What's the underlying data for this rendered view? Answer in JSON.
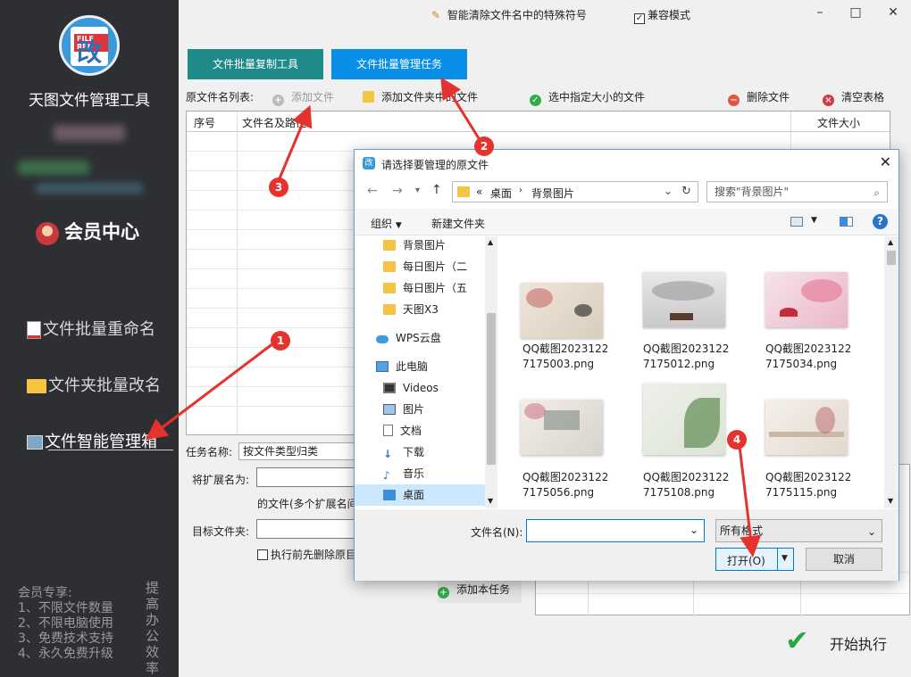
{
  "app": {
    "logo_tag": "FILE REN",
    "logo_char": "改",
    "title": "天图文件管理工具",
    "member_center": "会员中心",
    "nav": [
      {
        "label": "文件批量重命名",
        "icon": "document-icon"
      },
      {
        "label": "文件夹批量改名",
        "icon": "folder-icon"
      },
      {
        "label": "文件智能管理箱",
        "icon": "manager-icon"
      }
    ],
    "perks": [
      "会员专享:",
      "1、不限文件数量",
      "2、不限电脑使用",
      "3、免费技术支持",
      "4、永久免费升级"
    ],
    "slogan": "提高办公效率"
  },
  "titlebar": {
    "tip": "智能清除文件名中的特殊符号",
    "compat_label": "兼容模式",
    "compat_checked": true,
    "minimize": "–",
    "maximize": "□",
    "close": "✕"
  },
  "tabs": [
    "文件批量复制工具",
    "文件批量管理任务"
  ],
  "toolbar": {
    "list_label": "原文件名列表:",
    "add_file": "添加文件",
    "add_folder": "添加文件夹中的文件",
    "select_size": "选中指定大小的文件",
    "delete": "删除文件",
    "clear": "清空表格"
  },
  "table": {
    "headers": [
      "序号",
      "文件名及路径",
      "文件大小"
    ]
  },
  "task": {
    "name_label": "任务名称:",
    "name_value": "按文件类型归类",
    "ext_label": "将扩展名为:",
    "ext_hint": "的文件(多个扩展名间",
    "target_label": "目标文件夹:",
    "delete_before": "执行前先删除原目",
    "add_task": "添加本任务",
    "start": "开始执行"
  },
  "dialog": {
    "title": "请选择要管理的原文件",
    "path_sep": "«",
    "path": [
      "桌面",
      "背景图片"
    ],
    "search_placeholder": "搜索\"背景图片\"",
    "organize": "组织",
    "new_folder": "新建文件夹",
    "tree": [
      {
        "label": "背景图片",
        "icon": "folder-icon"
      },
      {
        "label": "每日图片（二",
        "icon": "folder-icon"
      },
      {
        "label": "每日图片（五",
        "icon": "folder-icon"
      },
      {
        "label": "天图X3",
        "icon": "folder-icon"
      },
      {
        "label": "WPS云盘",
        "icon": "cloud-icon"
      },
      {
        "label": "此电脑",
        "icon": "computer-icon"
      },
      {
        "label": "Videos",
        "icon": "video-icon"
      },
      {
        "label": "图片",
        "icon": "picture-icon"
      },
      {
        "label": "文档",
        "icon": "document-icon"
      },
      {
        "label": "下载",
        "icon": "download-icon"
      },
      {
        "label": "音乐",
        "icon": "music-icon"
      },
      {
        "label": "桌面",
        "icon": "desktop-icon"
      }
    ],
    "files": [
      {
        "name": "QQ截图20231227175003.png"
      },
      {
        "name": "QQ截图20231227175012.png"
      },
      {
        "name": "QQ截图20231227175034.png"
      },
      {
        "name": "QQ截图20231227175056.png"
      },
      {
        "name": "QQ截图20231227175108.png"
      },
      {
        "name": "QQ截图20231227175115.png"
      }
    ],
    "filename_label": "文件名(N):",
    "filename_value": "",
    "filter": "所有格式",
    "open": "打开(O)",
    "cancel": "取消"
  },
  "steps": [
    "1",
    "2",
    "3",
    "4"
  ],
  "colors": {
    "sidebar": "#2d2f33",
    "tab_copy": "#1f8a8a",
    "tab_manage": "#0a8fe8",
    "annotation": "#e5322d",
    "accent": "#0078d7"
  }
}
